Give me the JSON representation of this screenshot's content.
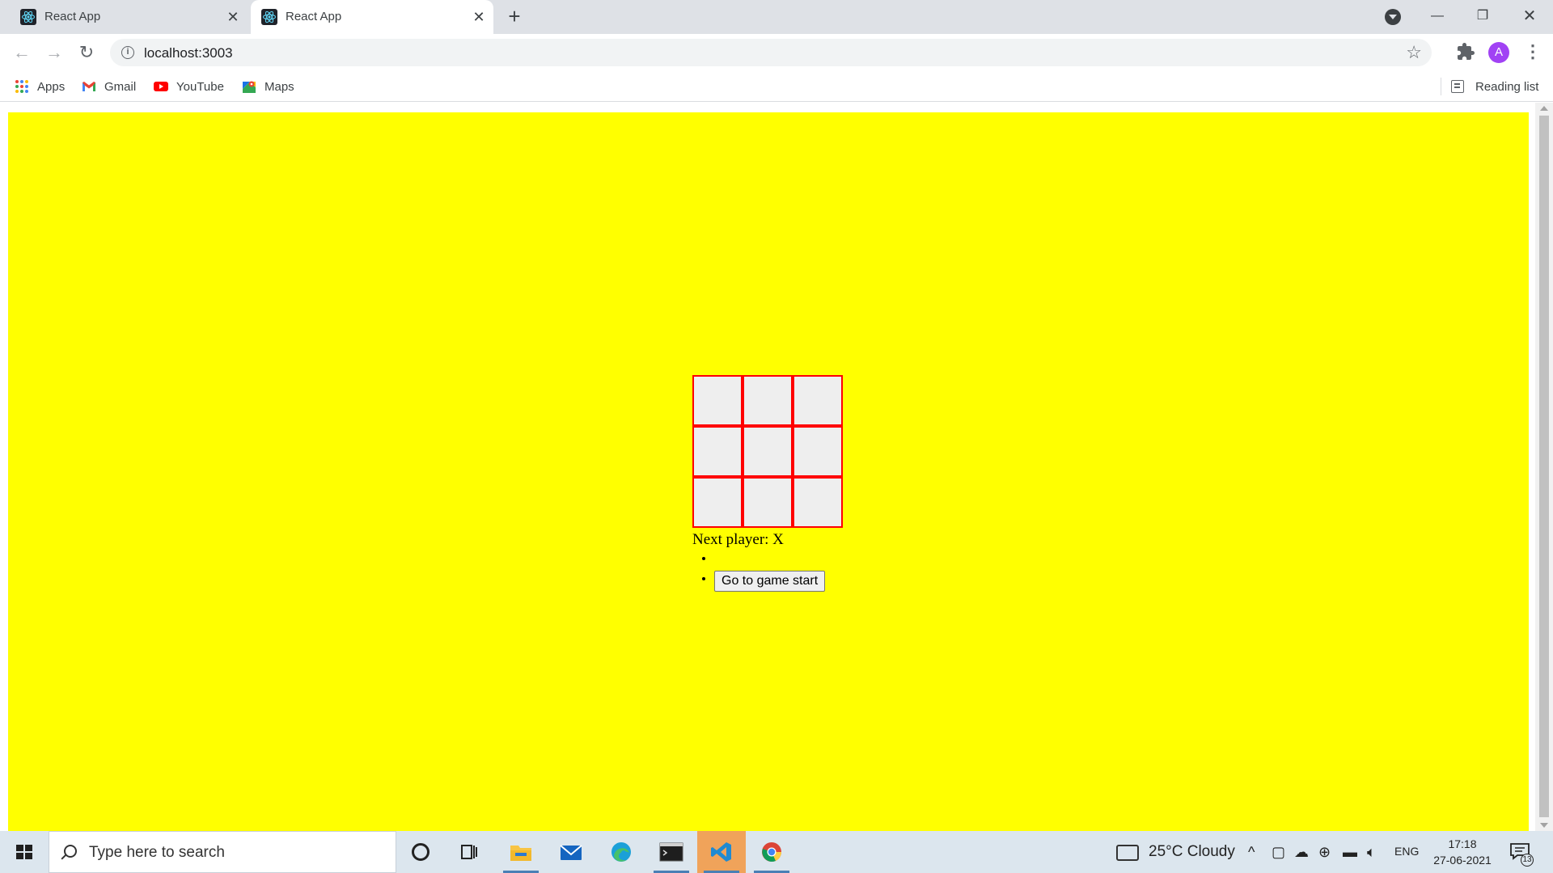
{
  "browser": {
    "tabs": [
      {
        "title": "React App",
        "active": false
      },
      {
        "title": "React App",
        "active": true
      }
    ],
    "url": "localhost:3003",
    "profile_initial": "A",
    "bookmarks": [
      {
        "label": "Apps",
        "icon": "apps-grid-icon"
      },
      {
        "label": "Gmail",
        "icon": "gmail-icon"
      },
      {
        "label": "YouTube",
        "icon": "youtube-icon"
      },
      {
        "label": "Maps",
        "icon": "maps-icon"
      }
    ],
    "reading_list_label": "Reading list"
  },
  "page": {
    "background_color": "#ffff00",
    "board": {
      "squares": [
        "",
        "",
        "",
        "",
        "",
        "",
        "",
        "",
        ""
      ],
      "border_color": "#ff0000"
    },
    "status": "Next player: X",
    "moves": [
      {
        "label": ""
      },
      {
        "label": "Go to game start"
      }
    ]
  },
  "taskbar": {
    "search_placeholder": "Type here to search",
    "weather": "25°C  Cloudy",
    "language": "ENG",
    "time": "17:18",
    "date": "27-06-2021",
    "notification_count": "13",
    "pinned_apps": [
      "file-explorer-icon",
      "mail-icon",
      "edge-icon",
      "terminal-icon",
      "vscode-icon",
      "chrome-icon"
    ]
  }
}
